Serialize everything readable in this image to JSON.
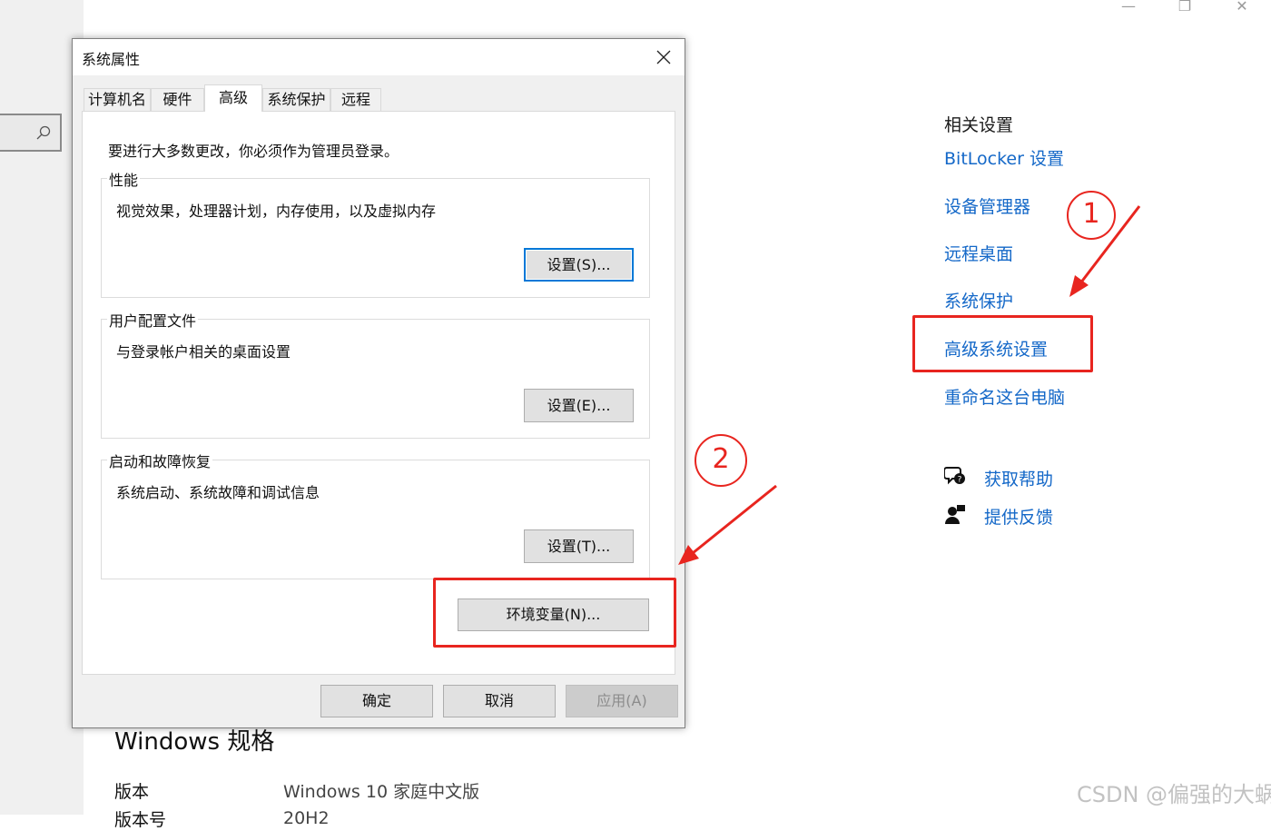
{
  "system_window": {
    "related_settings": {
      "title": "相关设置",
      "links": [
        "BitLocker 设置",
        "设备管理器",
        "远程桌面",
        "系统保护",
        "高级系统设置",
        "重命名这台电脑"
      ]
    },
    "help": {
      "get_help": "获取帮助",
      "feedback": "提供反馈"
    },
    "windows_spec": {
      "title": "Windows 规格",
      "edition_label": "版本",
      "edition_value": "Windows 10 家庭中文版",
      "version_label": "版本号",
      "version_value": "20H2"
    },
    "controls": {
      "minimize": "—",
      "restore": "❐",
      "close": "✕"
    }
  },
  "dialog": {
    "title": "系统属性",
    "tabs": [
      "计算机名",
      "硬件",
      "高级",
      "系统保护",
      "远程"
    ],
    "active_tab": "高级",
    "admin_notice": "要进行大多数更改，你必须作为管理员登录。",
    "groups": [
      {
        "label": "性能",
        "description": "视觉效果，处理器计划，内存使用，以及虚拟内存",
        "button": "设置(S)..."
      },
      {
        "label": "用户配置文件",
        "description": "与登录帐户相关的桌面设置",
        "button": "设置(E)..."
      },
      {
        "label": "启动和故障恢复",
        "description": "系统启动、系统故障和调试信息",
        "button": "设置(T)..."
      }
    ],
    "env_button": "环境变量(N)...",
    "footer": {
      "ok": "确定",
      "cancel": "取消",
      "apply": "应用(A)"
    }
  },
  "annotations": {
    "step1": "1",
    "step2": "2",
    "color": "#e8251f"
  },
  "watermark": "CSDN @偏强的大蜗牛",
  "colors": {
    "link": "#1468c8",
    "dialog_bg": "#f0f0f0",
    "default_button_border": "#0078d7"
  }
}
